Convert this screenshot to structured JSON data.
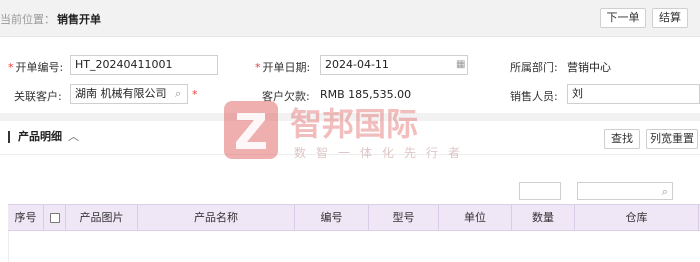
{
  "breadcrumb": {
    "prefix": "当前位置：",
    "current": "销售开单"
  },
  "toolbar": {
    "next_label": "下一单",
    "settle_label": "结算"
  },
  "form": {
    "order_no_label": "开单编号:",
    "order_no_value": "HT_20240411001",
    "order_date_label": "开单日期:",
    "order_date_value": "2024-04-11",
    "department_label": "所属部门:",
    "department_value": "营销中心",
    "customer_label": "关联客户:",
    "customer_value": "湖南        机械有限公司",
    "debt_label": "客户欠款:",
    "debt_value": "RMB 185,535.00",
    "salesperson_label": "销售人员:",
    "salesperson_value": "刘"
  },
  "section": {
    "title": "产品明细",
    "chevron": "︿",
    "find_label": "查找",
    "reset_label": "列宽重置"
  },
  "table": {
    "columns": [
      "序号",
      "",
      "产品图片",
      "产品名称",
      "编号",
      "型号",
      "单位",
      "数量",
      "仓库"
    ]
  },
  "watermark": {
    "brand": "智邦国际",
    "slogan": "数智一体化先行者"
  },
  "colors": {
    "table_header_bg": "#efe6f6",
    "required_mark": "#e23b3b",
    "watermark": "#e36e6e"
  }
}
